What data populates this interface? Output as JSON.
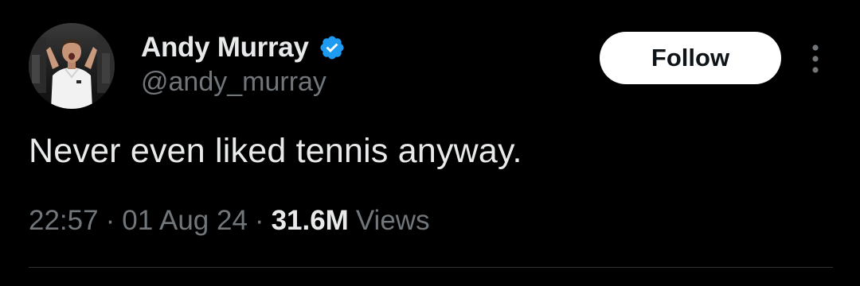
{
  "author": {
    "display_name": "Andy Murray",
    "handle": "@andy_murray",
    "verified": true,
    "verified_color": "#1d9bf0"
  },
  "actions": {
    "follow_label": "Follow",
    "more_icon": "more-vertical-icon"
  },
  "tweet": {
    "text": "Never even liked tennis anyway."
  },
  "meta": {
    "time": "22:57",
    "separator": "·",
    "date": "01 Aug 24",
    "views_count": "31.6M",
    "views_label": "Views"
  },
  "colors": {
    "background": "#000000",
    "primary_text": "#e7e9ea",
    "secondary_text": "#71767b",
    "follow_bg": "#ffffff",
    "follow_text": "#0f1419",
    "divider": "#2f3336"
  }
}
